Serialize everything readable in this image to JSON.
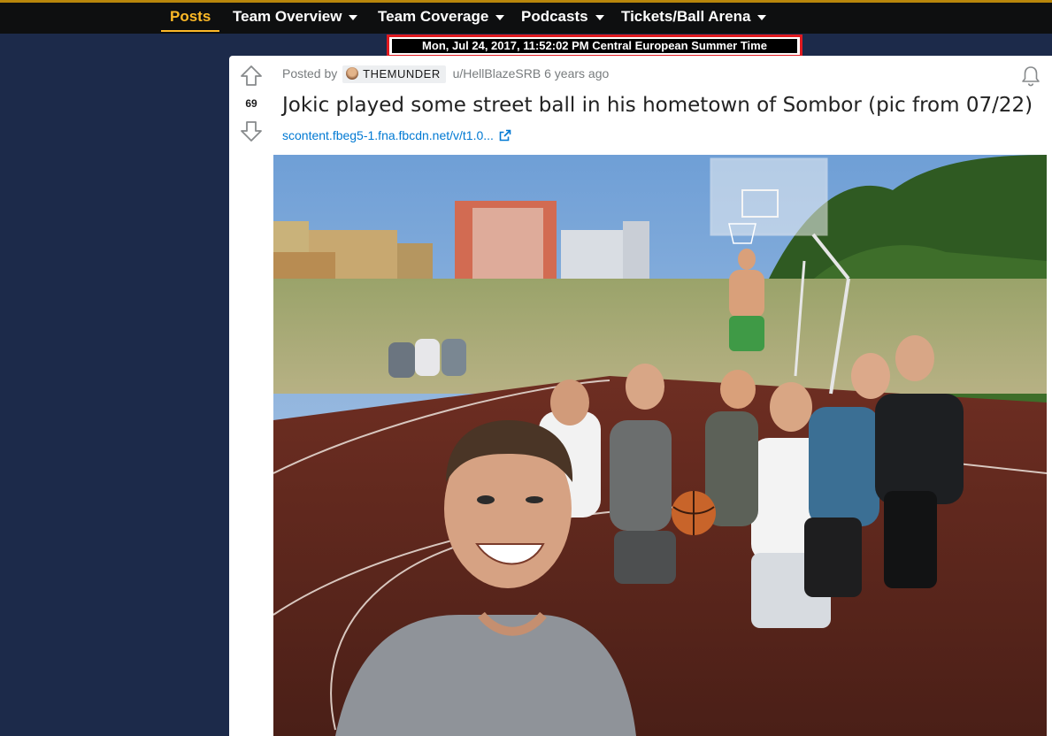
{
  "nav": {
    "items": [
      {
        "label": "Posts",
        "active": true
      },
      {
        "label": "Team Overview",
        "dropdown": true
      },
      {
        "label": "Team Coverage",
        "dropdown": true
      },
      {
        "label": "Podcasts",
        "dropdown": true
      },
      {
        "label": "Tickets/Ball Arena",
        "dropdown": true
      }
    ]
  },
  "timestamp_overlay": "Mon, Jul 24, 2017, 11:52:02 PM Central European Summer Time",
  "post": {
    "score": "69",
    "posted_by_label": "Posted by",
    "flair": "THEMUNDER",
    "author": "u/HellBlazeSRB",
    "age": "6 years ago",
    "title": "Jokic played some street ball in his hometown of Sombor (pic from 07/22)",
    "link_text": "scontent.fbeg5-1.fna.fbcdn.net/v/t1.0..."
  },
  "icons": {
    "upvote": "arrow-up-outline-icon",
    "downvote": "arrow-down-outline-icon",
    "notify": "bell-icon",
    "external": "external-link-icon"
  },
  "colors": {
    "page_bg": "#1c2a4a",
    "nav_bg": "#0e0f10",
    "nav_active": "#fdb927",
    "highlight_border": "#e0191f",
    "link": "#0079d3"
  }
}
